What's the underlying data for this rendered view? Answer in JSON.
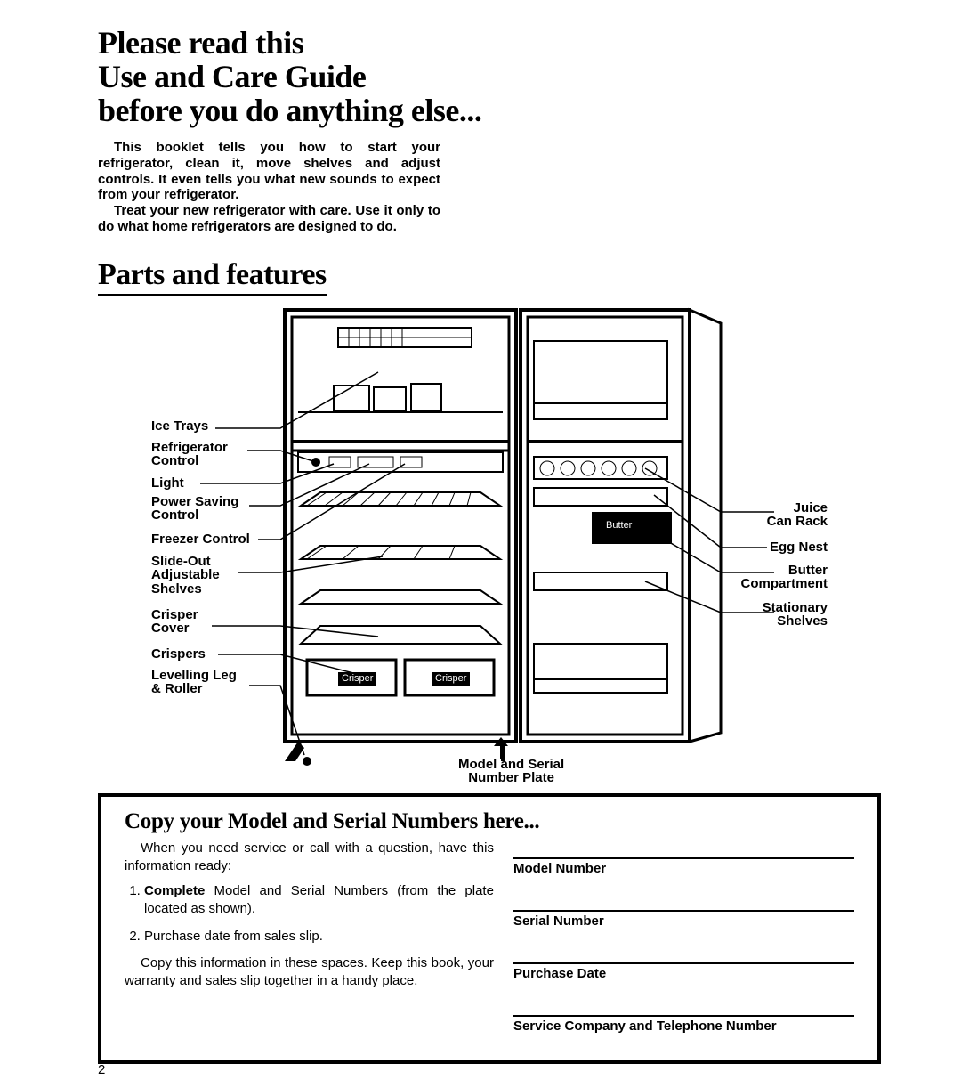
{
  "title": "Please read this\nUse and Care Guide\nbefore you do anything else...",
  "intro": {
    "p1": "This booklet tells you how to start your refrigerator, clean it, move shelves and adjust controls. It even tells you what new sounds to expect from your refrigerator.",
    "p2": "Treat your new refrigerator with care. Use it only to do what home refrigerators are designed to do."
  },
  "section_heading": "Parts and features",
  "diagram": {
    "callouts_left": {
      "ice_trays": "Ice Trays",
      "refrigerator_control": "Refrigerator\nControl",
      "light": "Light",
      "power_saving_control": "Power Saving\nControl",
      "freezer_control": "Freezer Control",
      "slide_out_shelves": "Slide-Out\nAdjustable\nShelves",
      "crisper_cover": "Crisper\nCover",
      "crispers": "Crispers",
      "levelling_leg": "Levelling Leg\n& Roller"
    },
    "callouts_right": {
      "juice_can_rack": "Juice\nCan Rack",
      "egg_nest": "Egg Nest",
      "butter_compartment": "Butter\nCompartment",
      "stationary_shelves": "Stationary\nShelves"
    },
    "callout_bottom": "Model and Serial\nNumber Plate",
    "inset_labels": {
      "butter": "Butter",
      "crisper1": "Crisper",
      "crisper2": "Crisper"
    }
  },
  "info_box": {
    "title": "Copy your Model and Serial Numbers here...",
    "intro": "When you need service or call with a question, have this information ready:",
    "item1_bold": "Complete",
    "item1_rest": " Model and Serial Numbers (from the plate located as shown).",
    "item2": "Purchase date from sales slip.",
    "outro": "Copy this information in these spaces. Keep this book, your warranty and sales slip together in a handy place.",
    "labels": {
      "model": "Model Number",
      "serial": "Serial Number",
      "date": "Purchase Date",
      "service": "Service Company and Telephone Number"
    }
  },
  "page_number": "2"
}
